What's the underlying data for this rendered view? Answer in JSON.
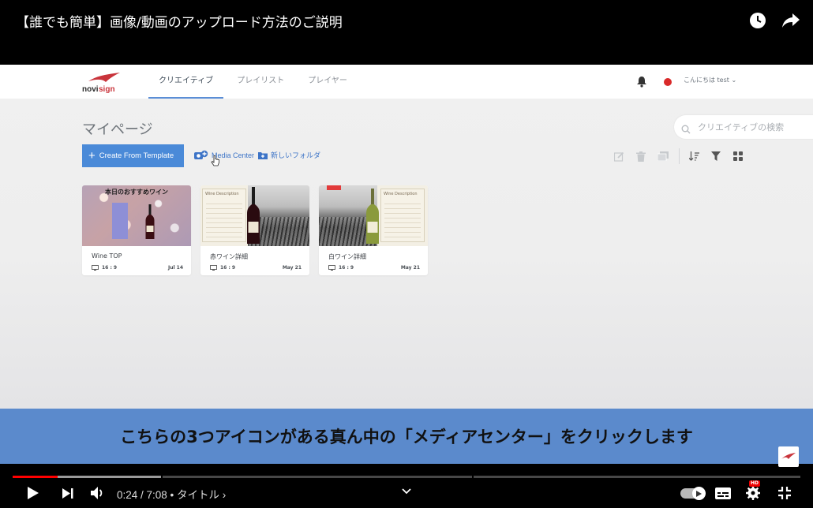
{
  "video": {
    "title": "【誰でも簡単】画像/動画のアップロード方法のご説明",
    "subtitle": "こちらの3つアイコンがある真ん中の「メディアセンター」をクリックします",
    "time_display": "0:24 / 7:08 • タイトル ›",
    "progress_fraction": 0.057,
    "buffer_fraction": 0.19
  },
  "app": {
    "nav": [
      "クリエイティブ",
      "プレイリスト",
      "プレイヤー"
    ],
    "greeting": "こんにちは test ⌄",
    "page_title": "マイページ",
    "search_placeholder": "クリエイティブの検索",
    "create_button": "Create From Template",
    "media_center": "Media Center",
    "new_folder": "新しいフォルダ",
    "cards": [
      {
        "title": "Wine TOP",
        "resolution": "16 : 9",
        "date": "Jul 14",
        "overlay": "本日のおすすめワイン"
      },
      {
        "title": "赤ワイン詳細",
        "resolution": "16 : 9",
        "date": "May 21",
        "overlay": "Wine Description"
      },
      {
        "title": "白ワイン詳細",
        "resolution": "16 : 9",
        "date": "May 21",
        "overlay": "Wine Description"
      }
    ]
  },
  "colors": {
    "accent": "#4a8ad8",
    "subtitle_bg": "#5b8acc",
    "progress_played": "#ff0000",
    "status_dot": "#d92a2a"
  },
  "icons": [
    "clock-icon",
    "share-icon",
    "bell-icon",
    "search-icon",
    "plus-icon",
    "media-icon",
    "folder-plus-icon",
    "edit-icon",
    "trash-icon",
    "copy-icon",
    "sort-icon",
    "filter-icon",
    "grid-icon",
    "play-icon",
    "next-icon",
    "volume-icon",
    "chevron-down-icon",
    "autoplay-toggle-icon",
    "captions-icon",
    "settings-icon",
    "exit-fullscreen-icon"
  ]
}
